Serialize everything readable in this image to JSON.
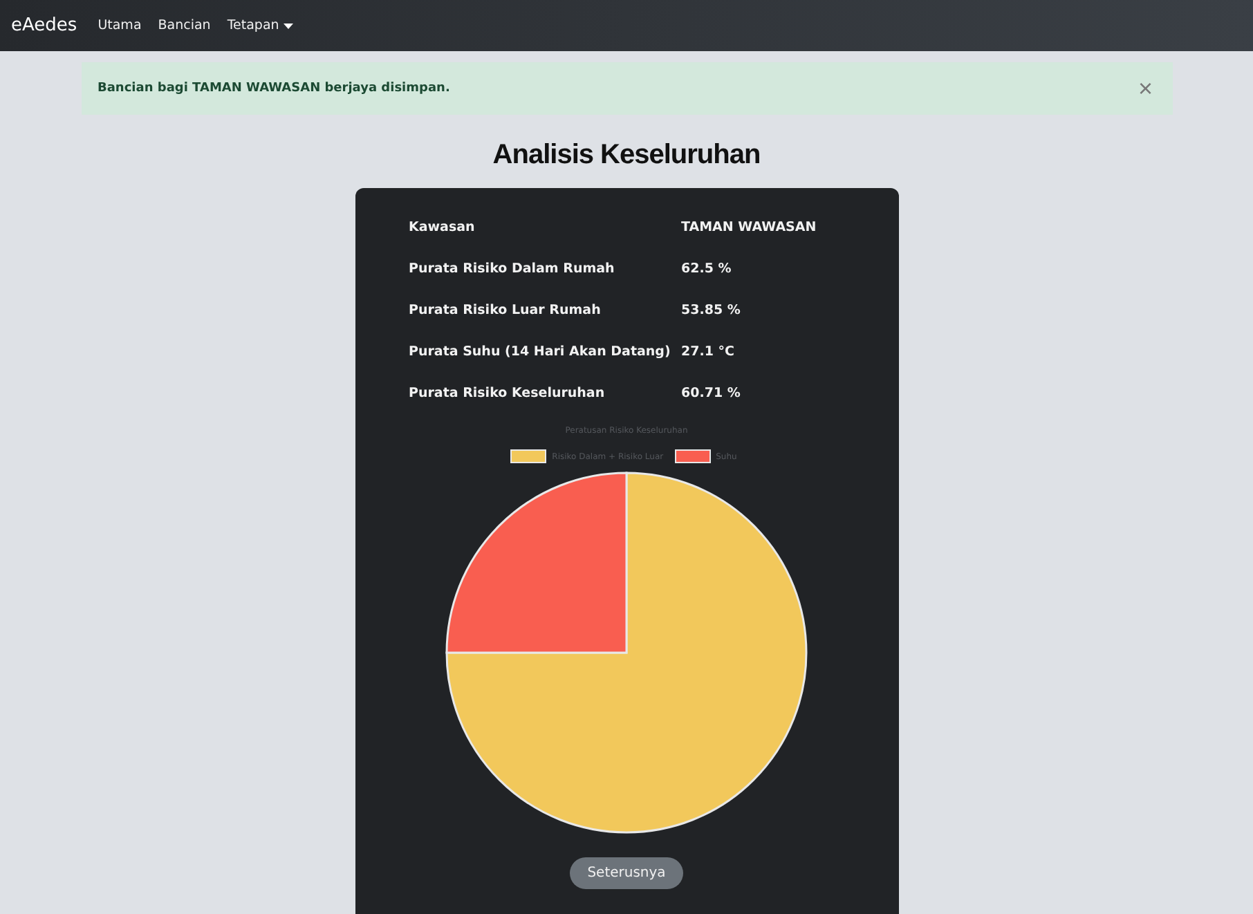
{
  "navbar": {
    "brand": "eAedes",
    "links": [
      {
        "label": "Utama",
        "dropdown": false
      },
      {
        "label": "Bancian",
        "dropdown": false
      },
      {
        "label": "Tetapan",
        "dropdown": true
      }
    ]
  },
  "alert": {
    "message": "Bancian bagi TAMAN WAWASAN berjaya disimpan.",
    "close": "×"
  },
  "title": "Analisis Keseluruhan",
  "summary": [
    {
      "label": "Kawasan",
      "value": "TAMAN WAWASAN"
    },
    {
      "label": "Purata Risiko Dalam Rumah",
      "value": "62.5 %"
    },
    {
      "label": "Purata Risiko Luar Rumah",
      "value": "53.85 %"
    },
    {
      "label": "Purata Suhu (14 Hari Akan Datang)",
      "value": "27.1 °C"
    },
    {
      "label": "Purata Risiko Keseluruhan",
      "value": "60.71 %"
    }
  ],
  "chart_data": {
    "type": "pie",
    "title": "Peratusan Risiko Keseluruhan",
    "categories": [
      "Risiko Dalam + Risiko Luar",
      "Suhu"
    ],
    "values": [
      75,
      25
    ],
    "legend": true,
    "colors": [
      "#f2c85b",
      "#f95e50"
    ]
  },
  "next_button": "Seterusnya"
}
